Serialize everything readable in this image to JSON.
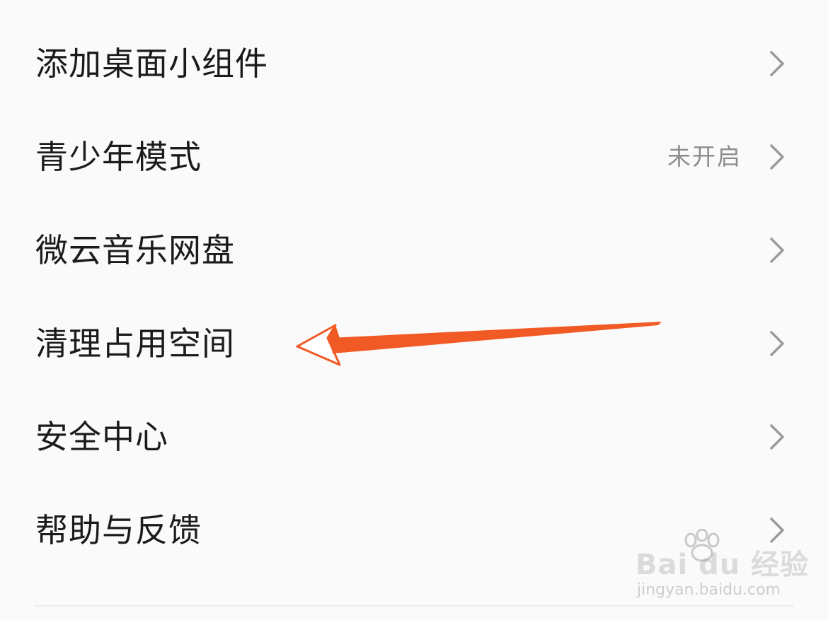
{
  "settings": {
    "items": [
      {
        "label": "添加桌面小组件",
        "value": ""
      },
      {
        "label": "青少年模式",
        "value": "未开启"
      },
      {
        "label": "微云音乐网盘",
        "value": ""
      },
      {
        "label": "清理占用空间",
        "value": ""
      },
      {
        "label": "安全中心",
        "value": ""
      },
      {
        "label": "帮助与反馈",
        "value": ""
      }
    ]
  },
  "annotation": {
    "arrow_color": "#f15a24"
  },
  "watermark": {
    "brand": "Bai du 经验",
    "site": "jingyan.baidu.com"
  },
  "colors": {
    "background": "#fafafa",
    "text": "#1b1b1b",
    "secondary_text": "#8c8c8c",
    "chevron": "#9a9a9a"
  },
  "icons": {
    "chevron": "chevron-right-icon",
    "watermark": "paw-icon"
  }
}
